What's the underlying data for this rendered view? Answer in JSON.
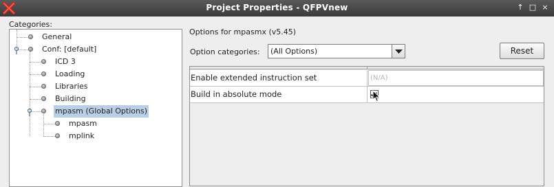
{
  "window": {
    "title": "Project Properties - QFPVnew",
    "controls": [
      "↑",
      "□",
      "×"
    ]
  },
  "categories": {
    "label": "Categories:",
    "tree": [
      {
        "label": "General"
      },
      {
        "label": "Conf: [default]"
      },
      {
        "label": "ICD 3"
      },
      {
        "label": "Loading"
      },
      {
        "label": "Libraries"
      },
      {
        "label": "Building"
      },
      {
        "label": "mpasm (Global Options)",
        "selected": true
      },
      {
        "label": "mpasm"
      },
      {
        "label": "mplink"
      }
    ]
  },
  "options": {
    "header": "Options for mpasmx (v5.45)",
    "option_categories_label": "Option categories:",
    "option_categories_value": "(All Options)",
    "reset_label": "Reset",
    "rows": [
      {
        "name": "Enable extended instruction set",
        "value": "(N/A)"
      },
      {
        "name": "Build in absolute mode",
        "checked": true
      }
    ]
  },
  "colors": {
    "selection": "#b8cfe5",
    "titlebar": "#3a3a3a",
    "close_icon": "#d8261c"
  }
}
